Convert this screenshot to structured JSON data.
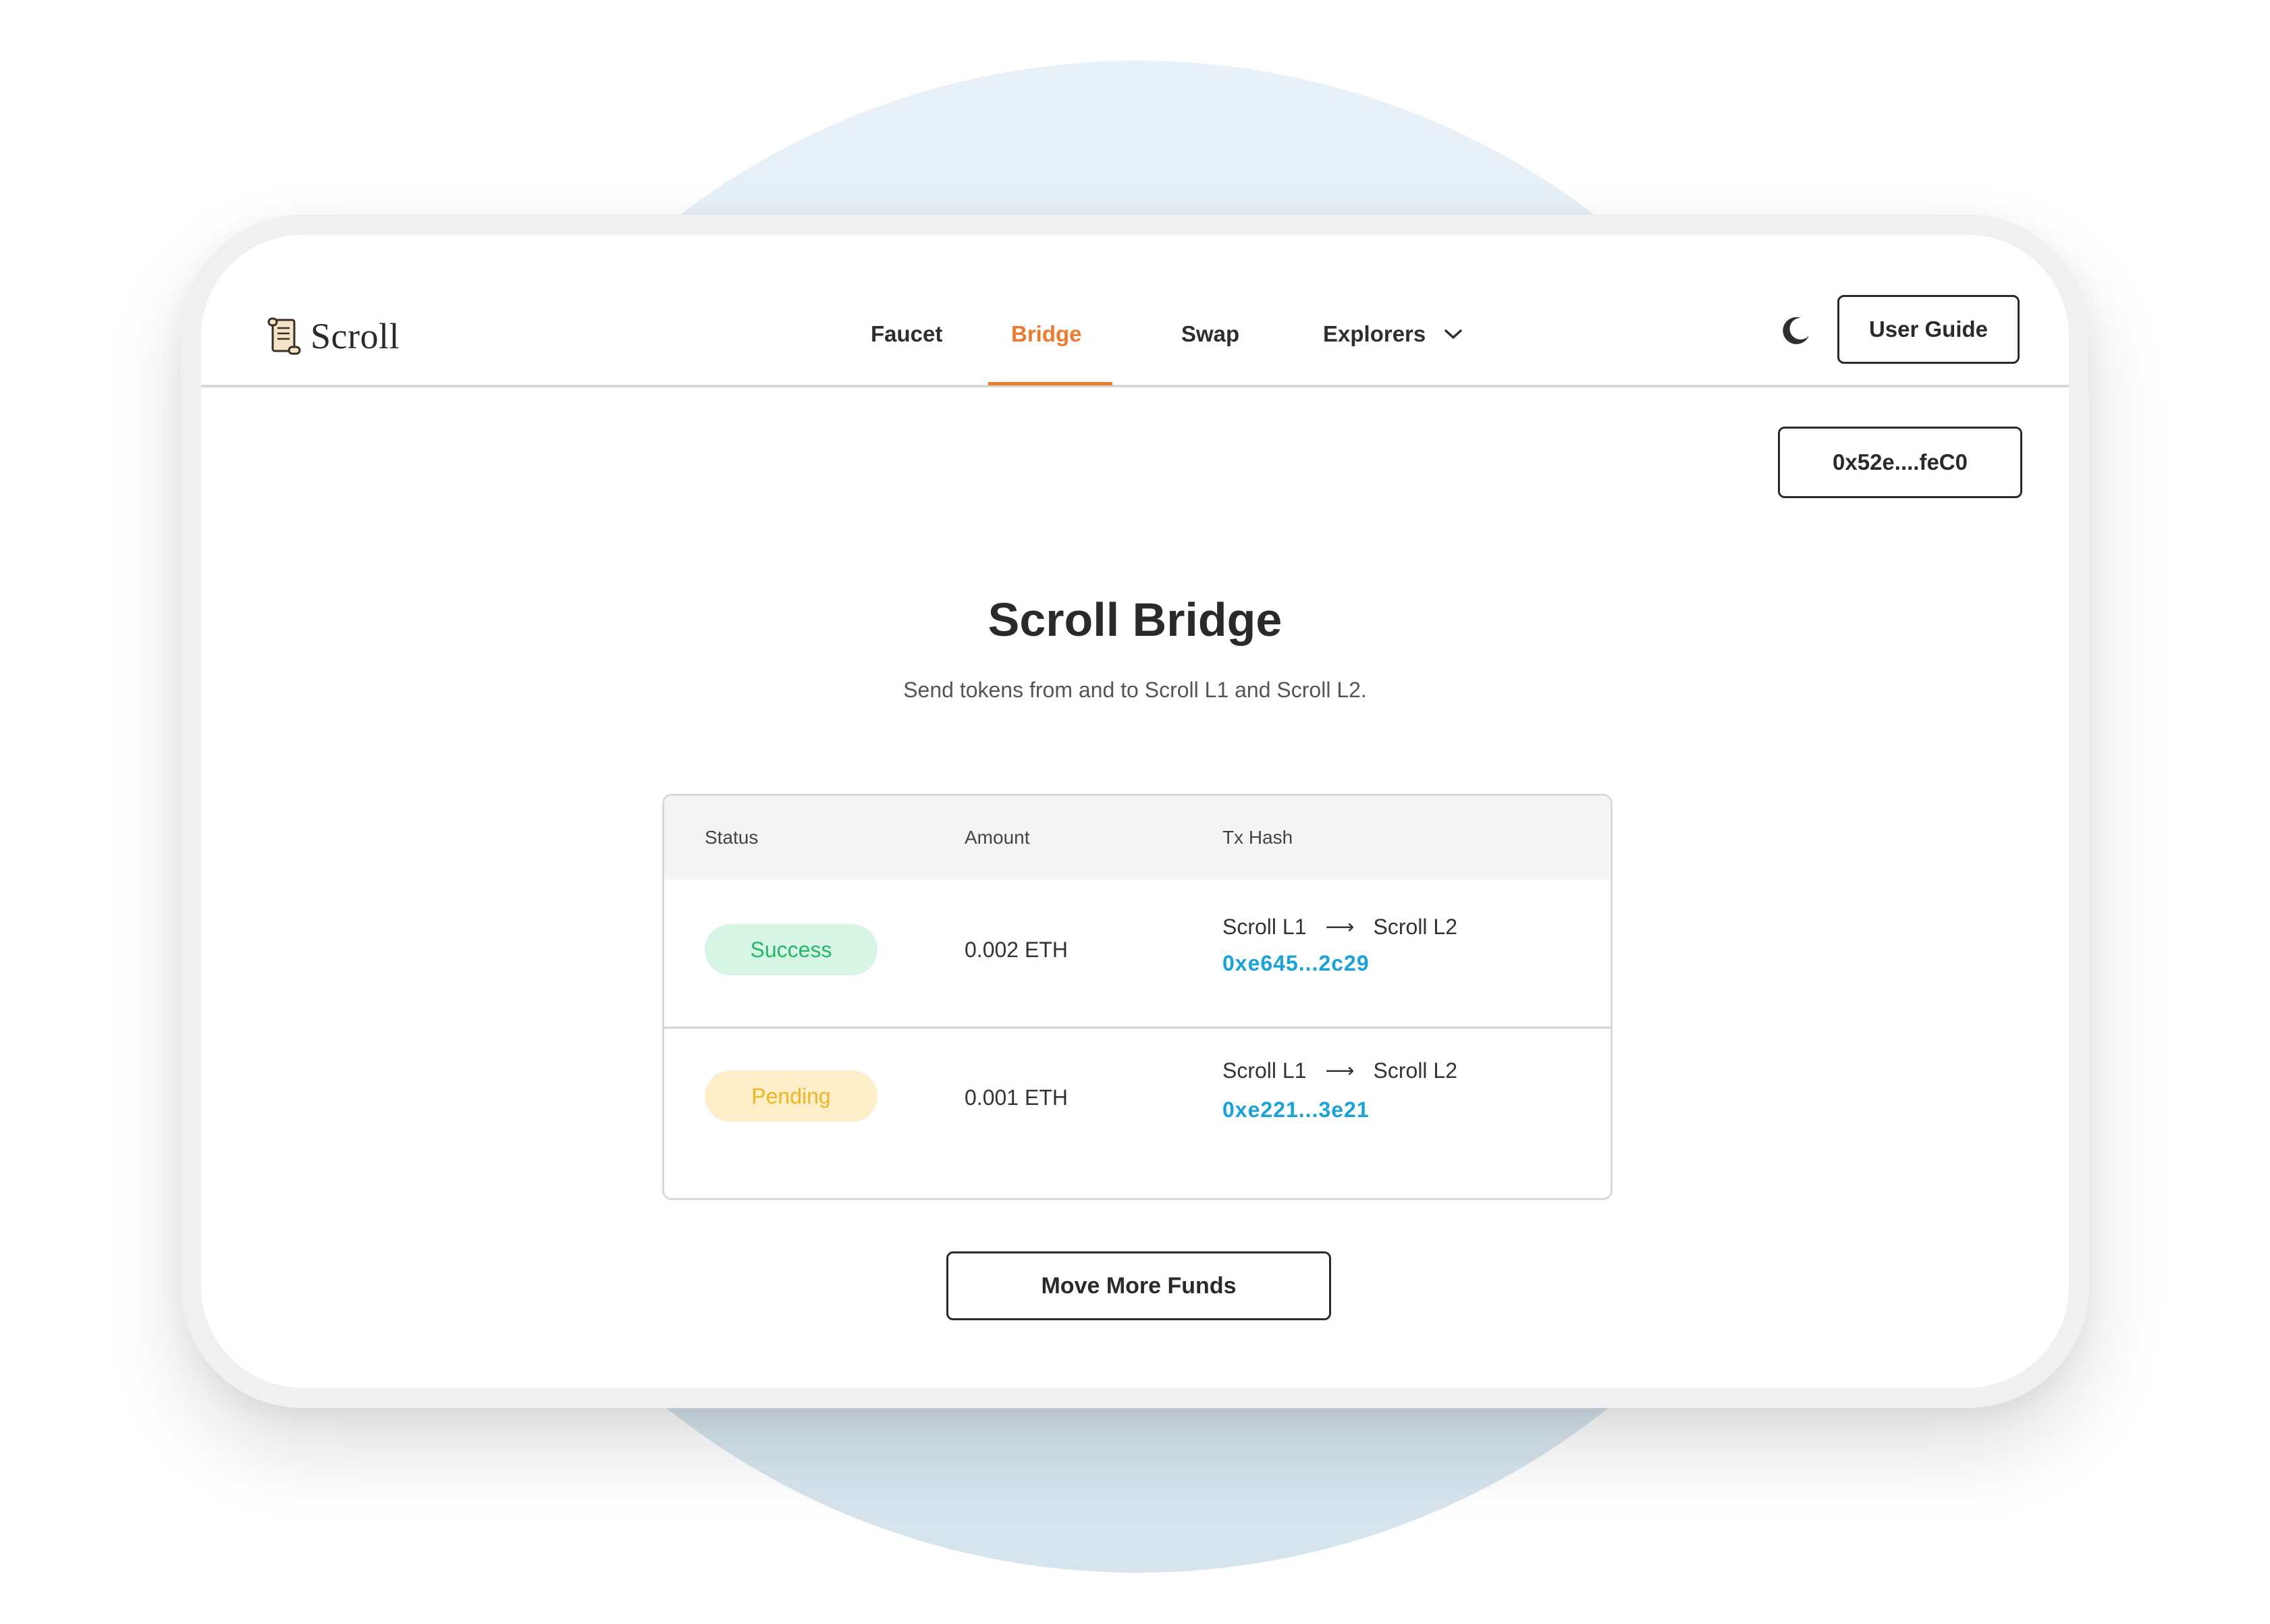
{
  "brand": {
    "name": "Scroll"
  },
  "nav": {
    "items": [
      {
        "label": "Faucet",
        "active": false
      },
      {
        "label": "Bridge",
        "active": true
      },
      {
        "label": "Swap",
        "active": false
      },
      {
        "label": "Explorers",
        "active": false,
        "icon": "chevron-down-icon"
      }
    ]
  },
  "header": {
    "theme_icon": "moon-icon",
    "user_guide_label": "User Guide"
  },
  "wallet": {
    "address": "0x52e....feC0"
  },
  "main": {
    "title": "Scroll Bridge",
    "subtitle": "Send tokens from and to Scroll L1 and Scroll L2."
  },
  "table": {
    "columns": [
      "Status",
      "Amount",
      "Tx Hash"
    ],
    "rows": [
      {
        "status": "Success",
        "amount": "0.002 ETH",
        "from": "Scroll L1",
        "to": "Scroll L2",
        "hash": "0xe645...2c29"
      },
      {
        "status": "Pending",
        "amount": "0.001 ETH",
        "from": "Scroll L1",
        "to": "Scroll L2",
        "hash": "0xe221...3e21"
      }
    ],
    "arrow": "⟶"
  },
  "actions": {
    "move_funds_label": "Move More Funds"
  },
  "colors": {
    "accent": "#ee7b2d",
    "success_bg": "#d6f5e5",
    "success_text": "#27b769",
    "pending_bg": "#fdedc8",
    "pending_text": "#efb523",
    "link": "#1aa3d9"
  }
}
